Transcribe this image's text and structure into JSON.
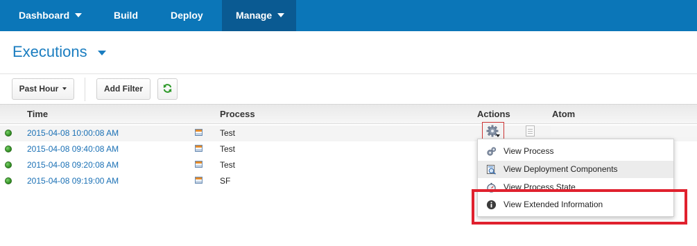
{
  "nav": {
    "items": [
      {
        "label": "Dashboard",
        "has_dropdown": true,
        "active": false
      },
      {
        "label": "Build",
        "has_dropdown": false,
        "active": false
      },
      {
        "label": "Deploy",
        "has_dropdown": false,
        "active": false
      },
      {
        "label": "Manage",
        "has_dropdown": true,
        "active": true
      }
    ],
    "color": "#0b76b8",
    "active_color": "#0a5a92"
  },
  "page": {
    "title": "Executions",
    "title_color": "#1a7dc0"
  },
  "toolbar": {
    "time_filter_label": "Past Hour",
    "add_filter_label": "Add Filter",
    "refresh_icon": "refresh-icon"
  },
  "table": {
    "headers": {
      "time": "Time",
      "process": "Process",
      "actions": "Actions",
      "atom": "Atom"
    },
    "rows": [
      {
        "status": "success",
        "time": "2015-04-08 10:00:08 AM",
        "process": "Test"
      },
      {
        "status": "success",
        "time": "2015-04-08 09:40:08 AM",
        "process": "Test"
      },
      {
        "status": "success",
        "time": "2015-04-08 09:20:08 AM",
        "process": "Test"
      },
      {
        "status": "success",
        "time": "2015-04-08 09:19:00 AM",
        "process": "SF"
      }
    ],
    "status_color": "#3fa02a",
    "link_color": "#1a70b5"
  },
  "actions_menu": {
    "items": [
      {
        "label": "View Process",
        "icon": "gears-icon"
      },
      {
        "label": "View Deployment Components",
        "icon": "deployment-components-icon"
      },
      {
        "label": "View Process State",
        "icon": "stopwatch-icon"
      },
      {
        "label": "View Extended Information",
        "icon": "info-icon"
      }
    ]
  },
  "annotation": {
    "highlight_color": "#e0212e"
  }
}
